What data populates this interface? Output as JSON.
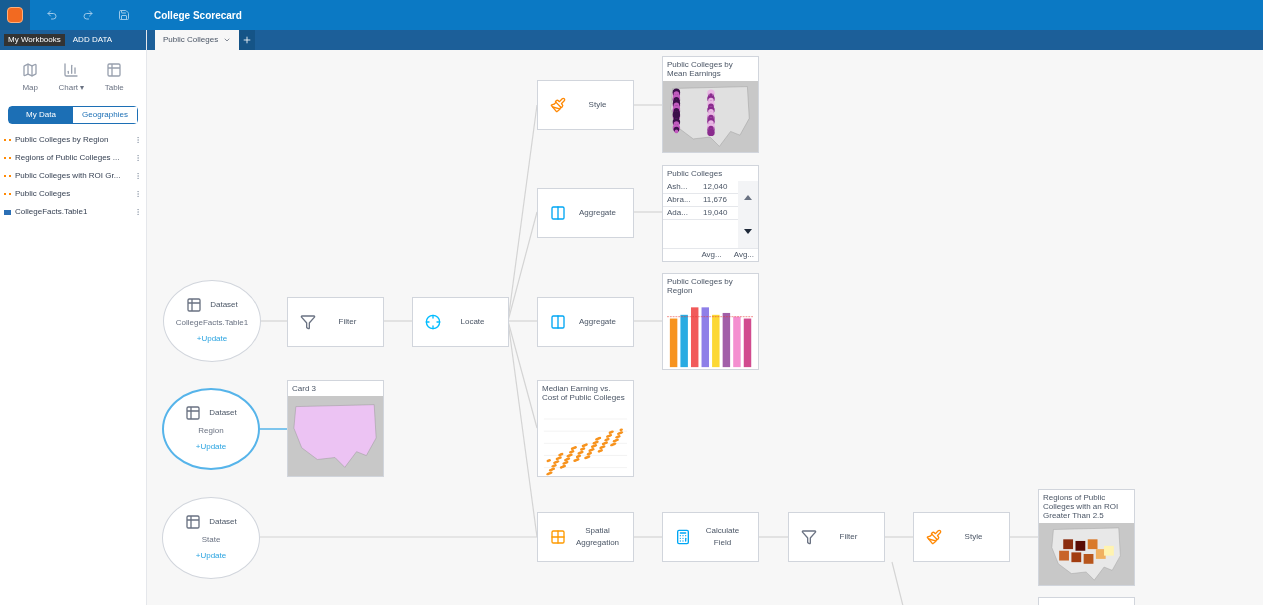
{
  "app": {
    "title": "College Scorecard"
  },
  "sidebar": {
    "workbooks": "My Workbooks",
    "add_data": "ADD DATA",
    "create": [
      {
        "kind": "map",
        "label": "Map"
      },
      {
        "kind": "chart",
        "label": "Chart ▾"
      },
      {
        "kind": "table",
        "label": "Table"
      }
    ],
    "data_tabs": [
      {
        "label": "My Data",
        "selected": true
      },
      {
        "label": "Geographies",
        "selected": false
      }
    ],
    "items": [
      {
        "kind": "layer",
        "name": "Public Colleges by Region"
      },
      {
        "kind": "layer",
        "name": "Regions of Public Colleges ..."
      },
      {
        "kind": "layer",
        "name": "Public Colleges with ROI Gr..."
      },
      {
        "kind": "layer",
        "name": "Public Colleges"
      },
      {
        "kind": "table",
        "name": "CollegeFacts.Table1"
      }
    ]
  },
  "page_tabs": [
    {
      "label": "Public Colleges",
      "selected": true
    }
  ],
  "datasets": [
    {
      "label": "Dataset",
      "name": "CollegeFacts.Table1",
      "action": "+Update",
      "selected": false
    },
    {
      "label": "Dataset",
      "name": "Region",
      "action": "+Update",
      "selected": true
    },
    {
      "label": "Dataset",
      "name": "State",
      "action": "+Update",
      "selected": false
    }
  ],
  "tools": [
    {
      "kind": "filter",
      "label": "Filter"
    },
    {
      "kind": "locate",
      "label": "Locate"
    },
    {
      "kind": "style",
      "label": "Style"
    },
    {
      "kind": "aggregate",
      "label": "Aggregate"
    },
    {
      "kind": "aggregate",
      "label": "Aggregate"
    },
    {
      "kind": "spatial",
      "label": "Spatial Aggregation"
    },
    {
      "kind": "calculate",
      "label": "Calculate Field"
    },
    {
      "kind": "filter",
      "label": "Filter"
    },
    {
      "kind": "style",
      "label": "Style"
    }
  ],
  "cards": [
    {
      "kind": "points-map",
      "title": "Public Colleges by Mean Earnings"
    },
    {
      "kind": "table",
      "title": "Public Colleges",
      "rows": [
        {
          "name": "Ash...",
          "value": "12,040"
        },
        {
          "name": "Abra...",
          "value": "11,676"
        },
        {
          "name": "Ada...",
          "value": "19,040"
        }
      ],
      "footer": [
        "Avg...",
        "Avg..."
      ]
    },
    {
      "kind": "bar",
      "title": "Public Colleges by Region"
    },
    {
      "kind": "region-map",
      "title": "Card 3"
    },
    {
      "kind": "scatter",
      "title": "Median Earning vs. Cost of Public Colleges"
    },
    {
      "kind": "choropleth",
      "title": "Regions of Public Colleges with an ROI Greater Than 2.5"
    },
    {
      "kind": "blank"
    }
  ]
}
